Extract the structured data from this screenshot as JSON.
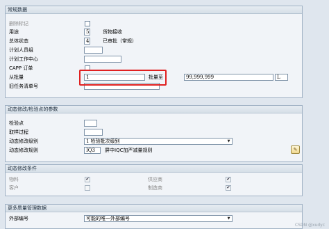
{
  "general": {
    "title": "常规数据",
    "deletion_flag": "删除标记",
    "usage": "用途",
    "usage_value": "5",
    "usage_desc": "货物接收",
    "overall_status": "总体状态",
    "status_value": "4",
    "status_desc": "已审批（常规）",
    "planner_group": "计划人员组",
    "plan_work_center": "计划工作中心",
    "capp_order": "CAPP 订单",
    "from_lot": "从批量",
    "from_lot_value": "1",
    "to_lot": "批量至",
    "to_lot_value": "99,999,999",
    "unit": "L",
    "old_task_list": "旧任务清单号"
  },
  "dynamic": {
    "title": "动态修改/检验点的参数",
    "inspection_point": "检验点",
    "sampling_procedure": "取样过程",
    "mod_level": "动态修改级别",
    "mod_level_value": "1 检验批次级别",
    "mod_rule": "动态修改规则",
    "mod_rule_value": "IQ3",
    "mod_rule_desc": "屏中IQC加严减量规则"
  },
  "conditions": {
    "title": "动态修改条件",
    "material": "物料",
    "vendor": "供应商",
    "customer": "客户",
    "manufacturer": "制造商"
  },
  "quality": {
    "title": "更多质量管理数据",
    "external_number": "外部编号",
    "external_value": "可能的唯一外部编号"
  },
  "watermark": "CSDN @xudyc",
  "colors": {
    "highlight": "#e02020",
    "group_header": "#d6dfe8"
  }
}
